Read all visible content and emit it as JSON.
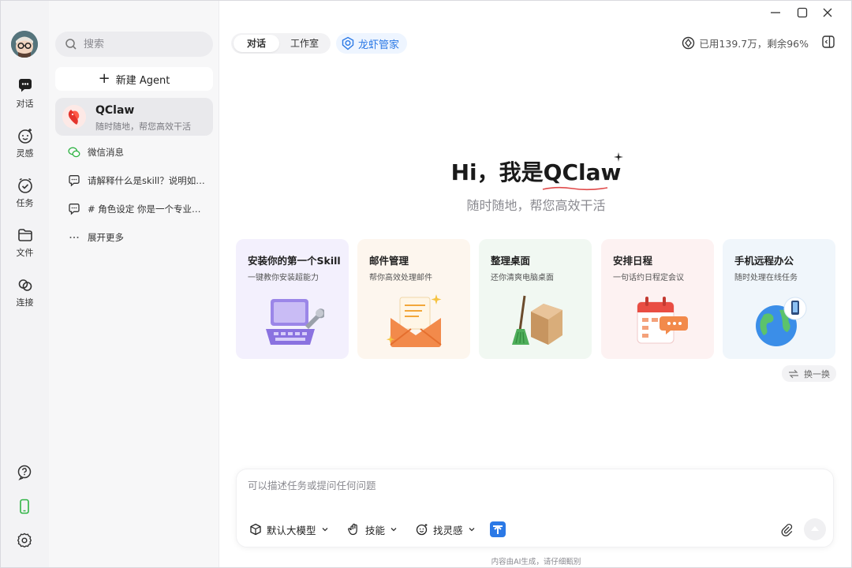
{
  "window": {
    "minimize_icon": "minimize-icon",
    "maximize_icon": "maximize-icon",
    "close_icon": "close-icon"
  },
  "rail": {
    "items": [
      {
        "label": "对话",
        "icon": "chat-icon"
      },
      {
        "label": "灵感",
        "icon": "inspiration-icon"
      },
      {
        "label": "任务",
        "icon": "task-icon"
      },
      {
        "label": "文件",
        "icon": "folder-icon"
      },
      {
        "label": "连接",
        "icon": "link-icon"
      }
    ],
    "bottom_icons": [
      "help-icon",
      "phone-icon",
      "settings-icon"
    ],
    "accent_green": "#2fb344"
  },
  "sidebar": {
    "search_placeholder": "搜索",
    "new_agent_label": "新建 Agent",
    "agent": {
      "name": "QClaw",
      "subtitle": "随时随地，帮您高效干活"
    },
    "chats": [
      {
        "label": "微信消息",
        "icon": "wechat-icon"
      },
      {
        "label": "请解释什么是skill？说明如…",
        "icon": "chat-bubble-icon"
      },
      {
        "label": "# 角色设定 你是一个专业的…",
        "icon": "chat-bubble-icon"
      },
      {
        "label": "展开更多",
        "icon": "more-icon"
      }
    ]
  },
  "header": {
    "tabs": [
      {
        "label": "对话",
        "active": true
      },
      {
        "label": "工作室",
        "active": false
      }
    ],
    "lobster_label": "龙虾管家",
    "usage_text": "已用139.7万，剩余96%",
    "accent_blue": "#2b79e6"
  },
  "hero": {
    "title": "Hi，我是QClaw",
    "subtitle": "随时随地，帮您高效干活"
  },
  "cards": [
    {
      "title": "安装你的第一个Skill",
      "subtitle": "一键教你安装超能力",
      "bg": "#f3f0fd",
      "icon": "laptop-wrench-icon"
    },
    {
      "title": "邮件管理",
      "subtitle": "帮你高效处理邮件",
      "bg": "#fdf6ee",
      "icon": "envelope-icon"
    },
    {
      "title": "整理桌面",
      "subtitle": "还你清爽电脑桌面",
      "bg": "#f1f8f2",
      "icon": "broom-box-icon"
    },
    {
      "title": "安排日程",
      "subtitle": "一句话约日程定会议",
      "bg": "#fdf2f2",
      "icon": "calendar-icon"
    },
    {
      "title": "手机远程办公",
      "subtitle": "随时处理在线任务",
      "bg": "#f0f6fb",
      "icon": "globe-phone-icon"
    }
  ],
  "refresh_label": "换一换",
  "composer": {
    "placeholder": "可以描述任务或提问任何问题",
    "model_label": "默认大模型",
    "skill_label": "技能",
    "inspiration_label": "找灵感"
  },
  "disclaimer": "内容由AI生成，请仔细甄别"
}
